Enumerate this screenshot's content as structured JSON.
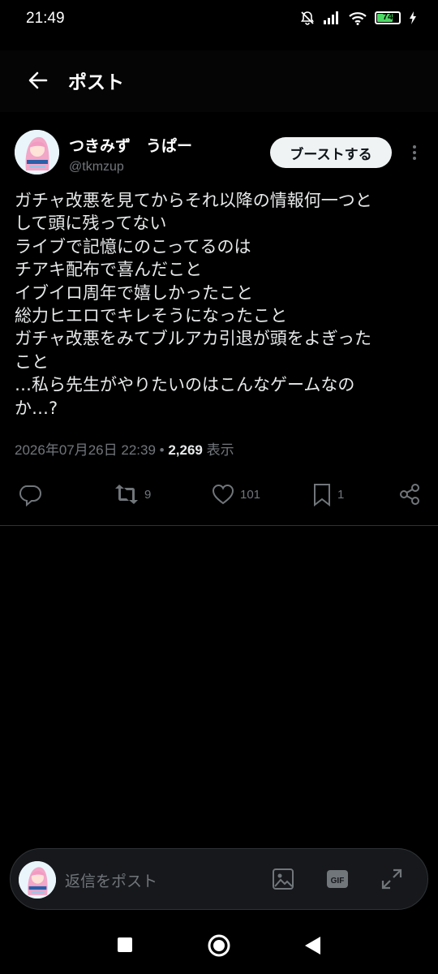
{
  "status_bar": {
    "time": "21:49",
    "battery_level": "74",
    "battery_percent": 74,
    "battery_color": "#4cd964"
  },
  "header": {
    "title": "ポスト"
  },
  "post": {
    "author": {
      "display_name": "つきみず　うぱー",
      "handle": "@tkmzup"
    },
    "boost_label": "ブーストする",
    "text_lines": [
      "ガチャ改悪を見てからそれ以降の情報何一つと",
      "して頭に残ってない",
      "ライブで記憶にのこってるのは",
      "チアキ配布で喜んだこと",
      "イブイロ周年で嬉しかったこと",
      "総力ヒエロでキレそうになったこと",
      "ガチャ改悪をみてブルアカ引退が頭をよぎった",
      "こと",
      "…私ら先生がやりたいのはこんなゲームなの",
      "か…?"
    ],
    "timestamp": "2026年07月26日 22:39",
    "separator": "•",
    "views_count": "2,269",
    "views_label": "表示",
    "actions": {
      "reply_count": "",
      "repost_count": "9",
      "like_count": "101",
      "bookmark_count": "1"
    }
  },
  "reply_bar": {
    "placeholder": "返信をポスト"
  },
  "icons": [
    "back-arrow-icon",
    "more-vertical-icon",
    "reply-icon",
    "repost-icon",
    "like-icon",
    "bookmark-icon",
    "share-icon",
    "image-icon",
    "gif-icon",
    "expand-icon"
  ]
}
